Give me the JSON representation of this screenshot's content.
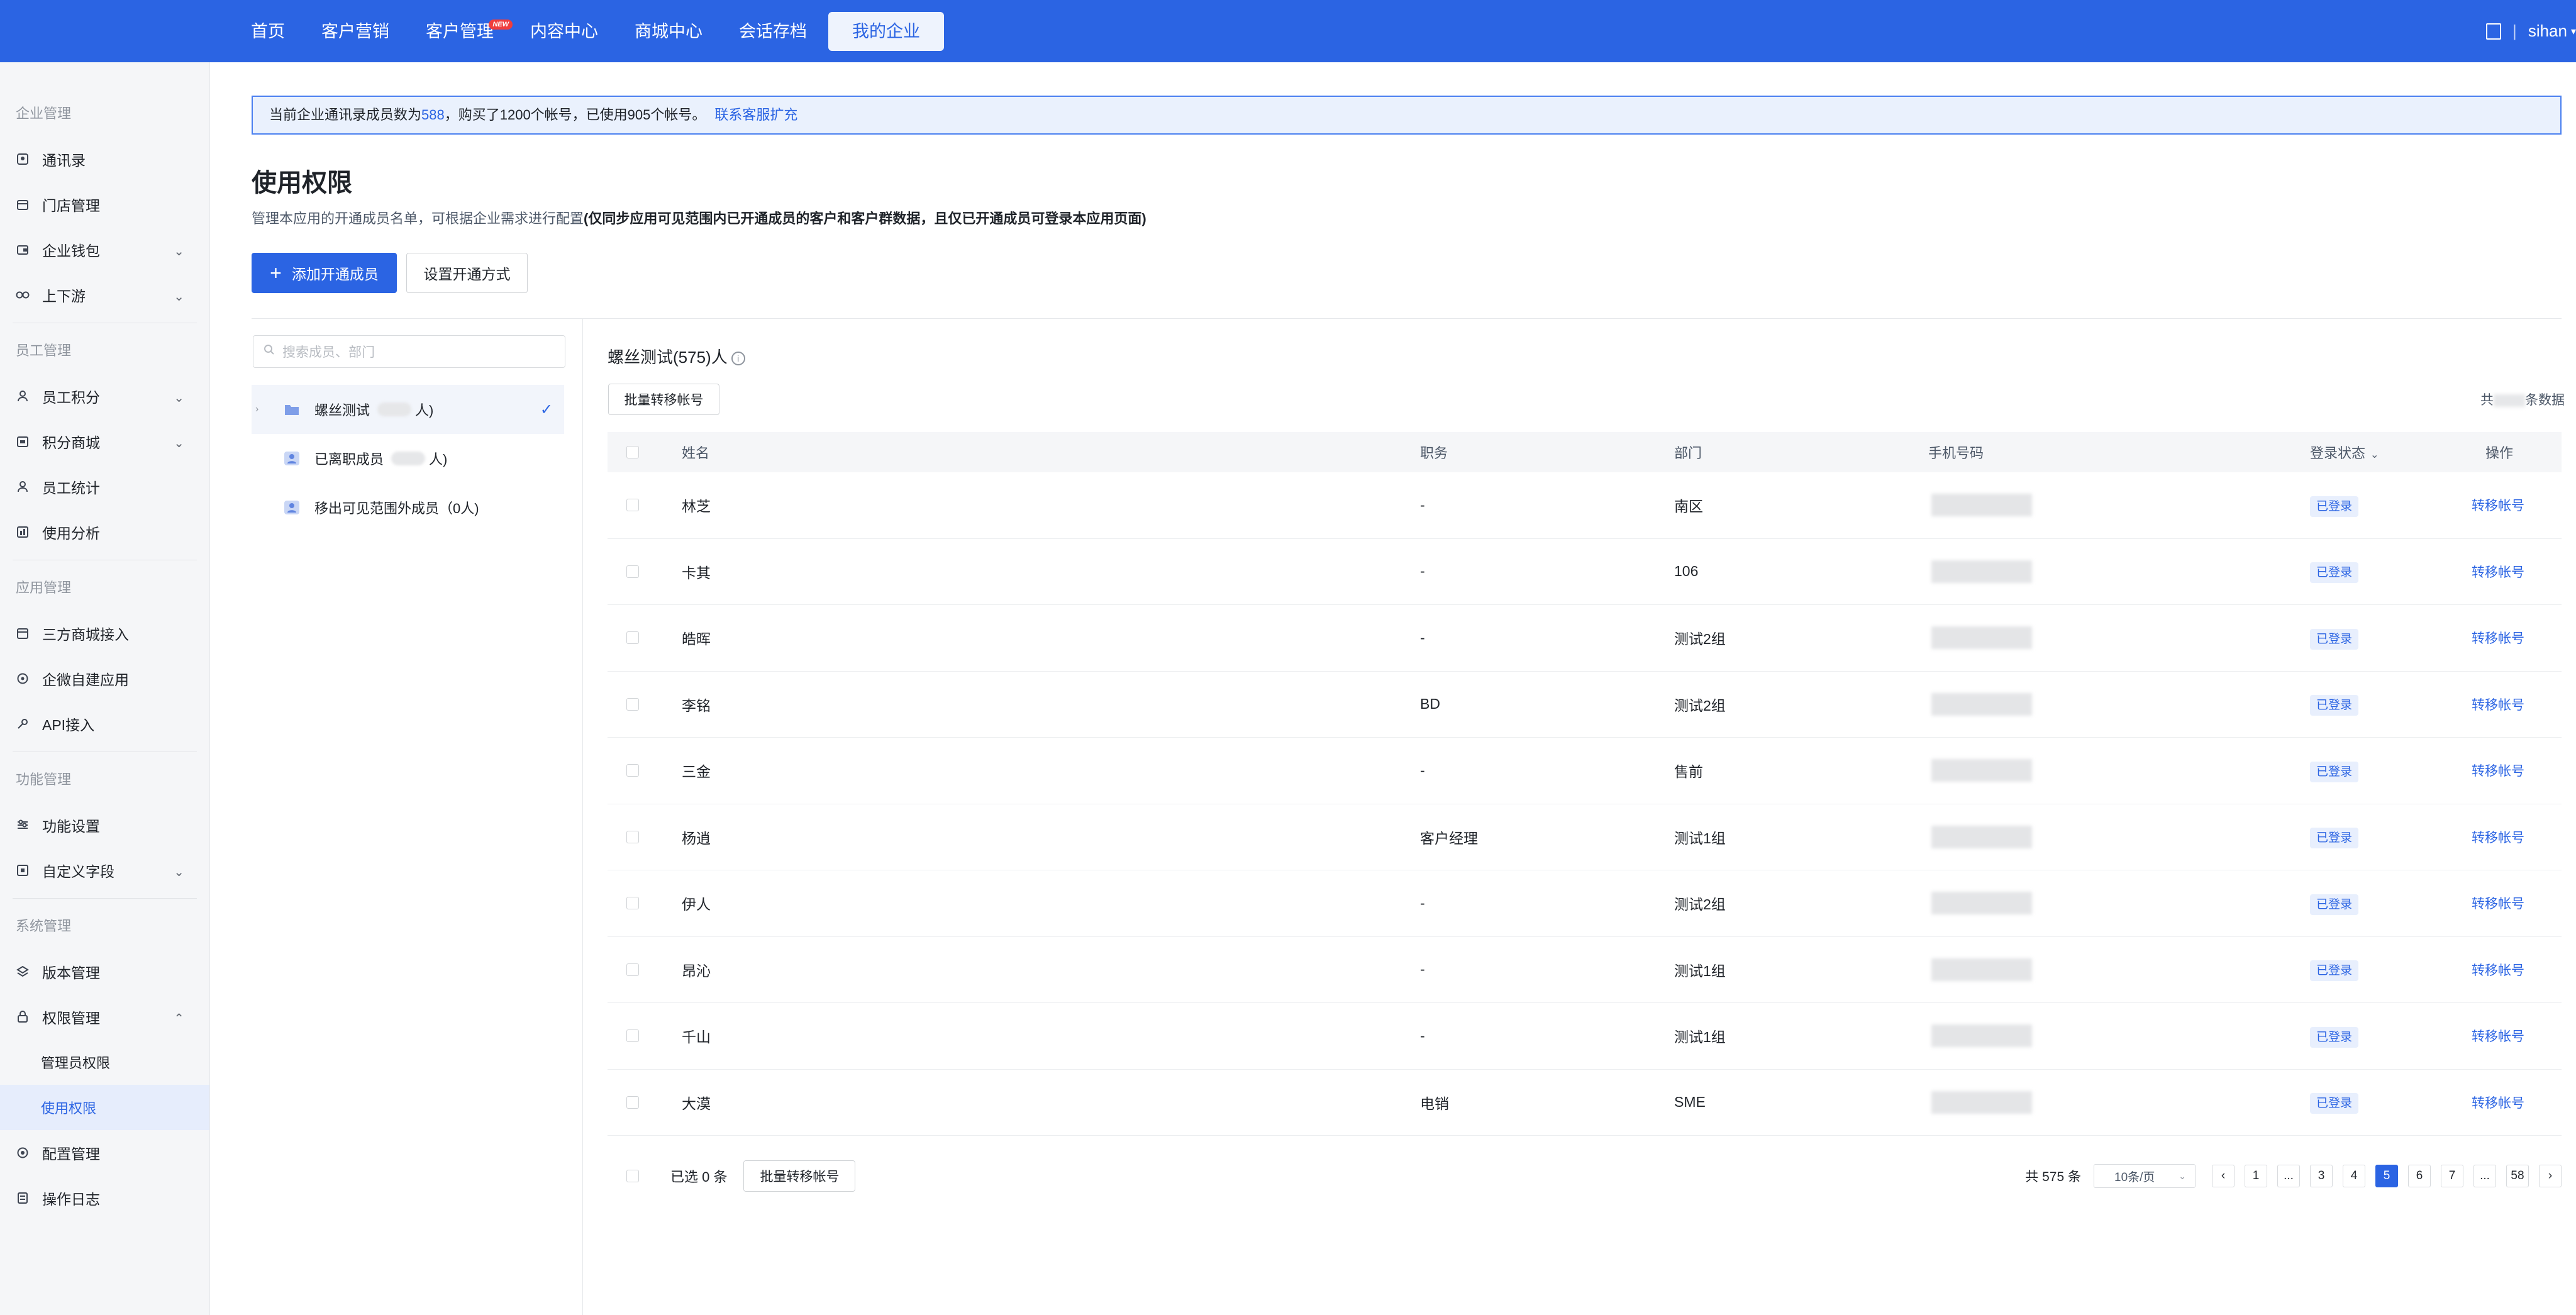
{
  "topnav": {
    "items": [
      "首页",
      "客户营销",
      "客户管理",
      "内容中心",
      "商城中心",
      "会话存档",
      "我的企业"
    ],
    "badge": "NEW",
    "user": "sihan"
  },
  "sidebar": {
    "groups": [
      {
        "title": "企业管理",
        "items": [
          "通讯录",
          "门店管理",
          "企业钱包",
          "上下游"
        ]
      },
      {
        "title": "员工管理",
        "items": [
          "员工积分",
          "积分商城",
          "员工统计",
          "使用分析"
        ]
      },
      {
        "title": "应用管理",
        "items": [
          "三方商城接入",
          "企微自建应用",
          "API接入"
        ]
      },
      {
        "title": "功能管理",
        "items": [
          "功能设置",
          "自定义字段"
        ]
      },
      {
        "title": "系统管理",
        "items": [
          "版本管理",
          "权限管理",
          "管理员权限",
          "使用权限",
          "配置管理",
          "操作日志"
        ]
      }
    ]
  },
  "notice": {
    "prefix": "当前企业通讯录成员数为",
    "count": "588",
    "suffix": "，购买了1200个帐号，已使用905个帐号。",
    "link": "联系客服扩充"
  },
  "page": {
    "title": "使用权限",
    "desc": "管理本应用的开通成员名单，可根据企业需求进行配置",
    "desc_bold": "(仅同步应用可见范围内已开通成员的客户和客户群数据，且仅已开通成员可登录本应用页面)",
    "add_btn": "添加开通成员",
    "setup_btn": "设置开通方式"
  },
  "tree": {
    "search_placeholder": "搜索成员、部门",
    "nodes": [
      {
        "label": "螺丝测试",
        "suffix": "人)"
      },
      {
        "label": "已离职成员",
        "suffix": "人)"
      },
      {
        "label": "移出可见范围外成员（0人)"
      }
    ]
  },
  "list": {
    "header": "螺丝测试(575)人",
    "batch_btn": "批量转移帐号",
    "total_top_prefix": "共",
    "total_top_suffix": "条数据",
    "columns": [
      "姓名",
      "职务",
      "部门",
      "手机号码",
      "登录状态",
      "操作"
    ],
    "rows": [
      {
        "name": "林芝",
        "role": "-",
        "dept": "南区",
        "status": "已登录",
        "op": "转移帐号"
      },
      {
        "name": "卡其",
        "role": "-",
        "dept": "106",
        "status": "已登录",
        "op": "转移帐号"
      },
      {
        "name": "皓晖",
        "role": "-",
        "dept": "测试2组",
        "status": "已登录",
        "op": "转移帐号"
      },
      {
        "name": "李铭",
        "role": "BD",
        "dept": "测试2组",
        "status": "已登录",
        "op": "转移帐号"
      },
      {
        "name": "三金",
        "role": "-",
        "dept": "售前",
        "status": "已登录",
        "op": "转移帐号"
      },
      {
        "name": "杨逍",
        "role": "客户经理",
        "dept": "测试1组",
        "status": "已登录",
        "op": "转移帐号"
      },
      {
        "name": "伊人",
        "role": "-",
        "dept": "测试2组",
        "status": "已登录",
        "op": "转移帐号"
      },
      {
        "name": "昂沁",
        "role": "-",
        "dept": "测试1组",
        "status": "已登录",
        "op": "转移帐号"
      },
      {
        "name": "千山",
        "role": "-",
        "dept": "测试1组",
        "status": "已登录",
        "op": "转移帐号"
      },
      {
        "name": "大漠",
        "role": "电销",
        "dept": "SME",
        "status": "已登录",
        "op": "转移帐号"
      }
    ],
    "footer": {
      "selected": "已选 0 条",
      "batch_btn": "批量转移帐号",
      "total": "共 575 条",
      "page_size": "10条/页",
      "pages": [
        "1",
        "...",
        "3",
        "4",
        "5",
        "6",
        "7",
        "...",
        "58"
      ],
      "current": "5"
    }
  },
  "colors": {
    "brand": "#2b64e3",
    "notice_bg": "#eaf1fd"
  }
}
